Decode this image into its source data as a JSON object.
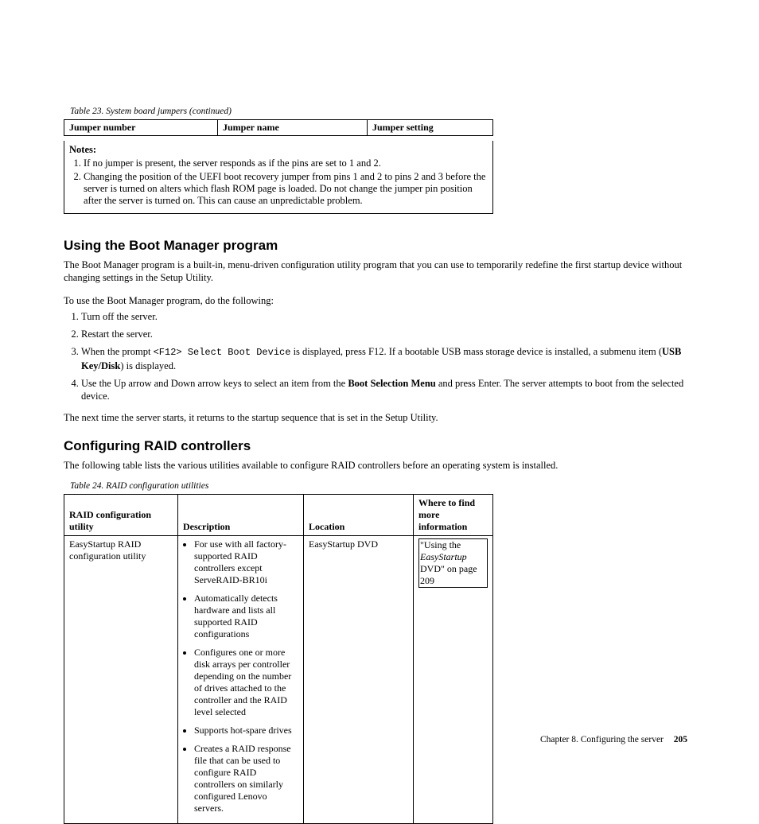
{
  "table23": {
    "caption": "Table 23. System board jumpers  (continued)",
    "headers": [
      "Jumper number",
      "Jumper name",
      "Jumper setting"
    ],
    "notes_title": "Notes:",
    "notes": [
      "If no jumper is present, the server responds as if the pins are set to 1 and 2.",
      "Changing the position of the UEFI boot recovery jumper from pins 1 and 2 to pins 2 and 3 before the server is turned on alters which flash ROM page is loaded. Do not change the jumper pin position after the server is turned on. This can cause an unpredictable problem."
    ]
  },
  "boot": {
    "heading": "Using the Boot Manager program",
    "p1": "The Boot Manager program is a built-in, menu-driven configuration utility program that you can use to temporarily redefine the first startup device without changing settings in the Setup Utility.",
    "p2": "To use the Boot Manager program, do the following:",
    "steps": {
      "s1": "Turn off the server.",
      "s2": "Restart the server.",
      "s3a": "When the prompt ",
      "s3code": "<F12> Select Boot Device",
      "s3b": " is displayed, press F12. If a bootable USB mass storage device is installed, a submenu item (",
      "s3bold": "USB Key/Disk",
      "s3c": ") is displayed.",
      "s4a": "Use the Up arrow and Down arrow keys to select an item from the ",
      "s4bold": "Boot Selection Menu",
      "s4b": " and press Enter. The server attempts to boot from the selected device."
    },
    "p3": "The next time the server starts, it returns to the startup sequence that is set in the Setup Utility."
  },
  "raid": {
    "heading": "Configuring RAID controllers",
    "p1": "The following table lists the various utilities available to configure RAID controllers before an operating system is installed.",
    "caption": "Table 24. RAID configuration utilities",
    "headers": [
      "RAID configuration utility",
      "Description",
      "Location",
      "Where to find more information"
    ],
    "row1": {
      "utility": "EasyStartup RAID configuration utility",
      "desc": [
        "For use with all factory-supported RAID controllers except ServeRAID-BR10i",
        "Automatically detects hardware and lists all supported RAID configurations",
        "Configures one or more disk arrays per controller depending on the number of drives attached to the controller and the RAID level selected",
        "Supports hot-spare drives",
        "Creates a RAID response file that can be used to configure RAID controllers on similarly configured Lenovo servers."
      ],
      "location": "EasyStartup DVD",
      "link_a": "\"Using the ",
      "link_it": "EasyStartup",
      "link_b": " DVD\" on page 209"
    }
  },
  "footer": {
    "chapter": "Chapter 8. Configuring the server",
    "page": "205"
  }
}
